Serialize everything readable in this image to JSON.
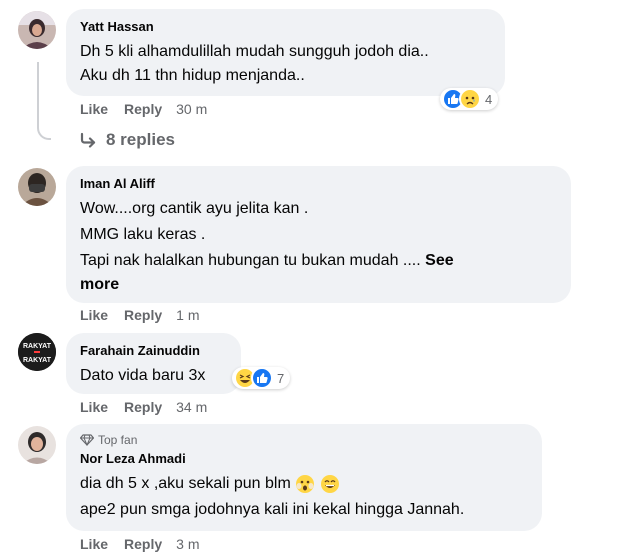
{
  "comments": [
    {
      "author": "Yatt Hassan",
      "lines": [
        "Dh 5 kli alhamdulillah mudah sungguh jodoh dia..",
        "Aku dh 11 thn hidup menjanda.."
      ],
      "like_label": "Like",
      "reply_label": "Reply",
      "time": "30 m",
      "reaction_count": "4",
      "reactions": [
        "like-reaction",
        "sad-reaction"
      ]
    },
    {
      "author": "Iman Al Aliff",
      "lines": [
        "Wow....org cantik ayu jelita kan .",
        "MMG laku keras .",
        "Tapi nak halalkan hubungan tu bukan mudah ...."
      ],
      "see_more_part1": "See",
      "see_more_part2": "more",
      "like_label": "Like",
      "reply_label": "Reply",
      "time": "1 m"
    },
    {
      "author": "Farahain Zainuddin",
      "avatar_text_top": "RAKYAT",
      "avatar_text_bottom": "RAKYAT",
      "lines": [
        "Dato vida baru 3x"
      ],
      "like_label": "Like",
      "reply_label": "Reply",
      "time": "34 m",
      "reaction_count": "7",
      "reactions": [
        "haha-reaction",
        "like-reaction"
      ]
    },
    {
      "badge": "Top fan",
      "author": "Nor Leza Ahmadi",
      "lines": [
        "dia dh 5 x ,aku sekali pun blm",
        "ape2 pun smga jodohnya kali ini kekal hingga Jannah."
      ],
      "like_label": "Like",
      "reply_label": "Reply",
      "time": "3 m"
    }
  ],
  "replies_label": "8 replies",
  "colors": {
    "bubble": "#f0f2f5",
    "meta": "#65676b",
    "like_blue": "#1877f2",
    "emoji_yellow": "#ffd645"
  }
}
